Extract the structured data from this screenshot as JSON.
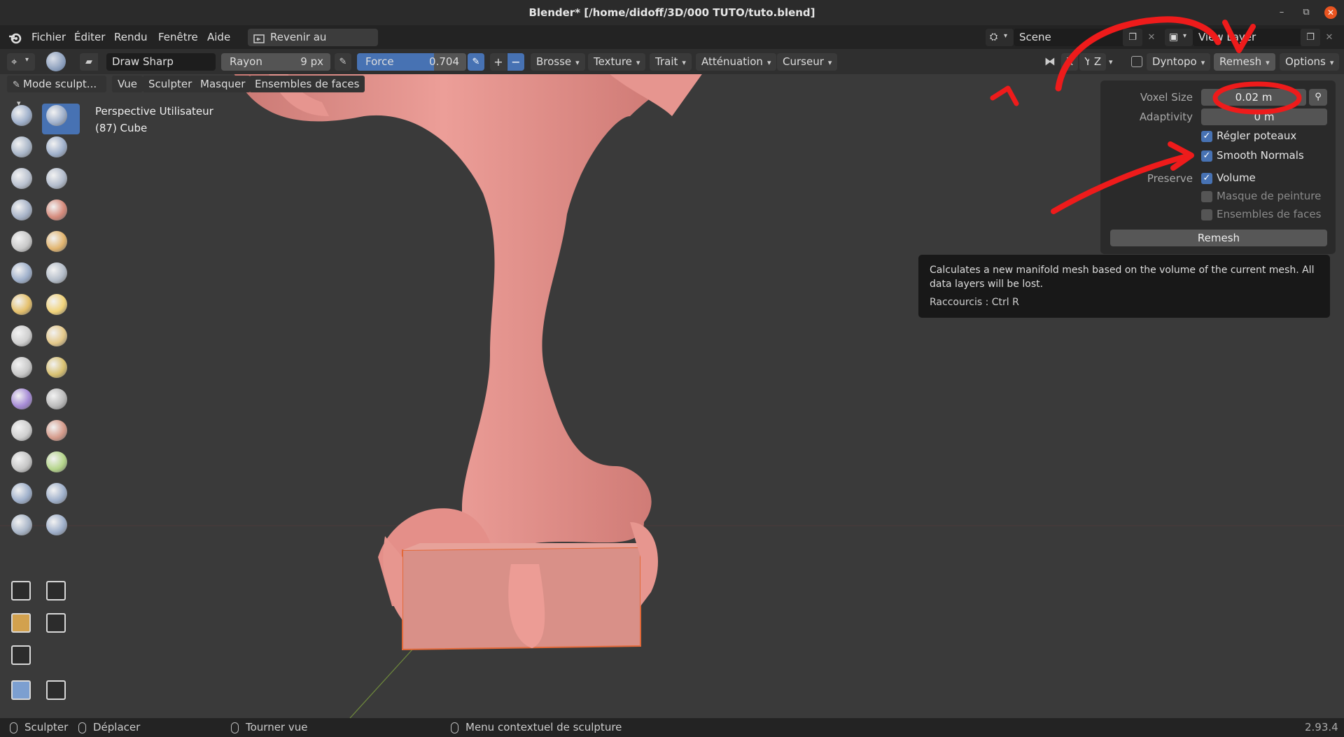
{
  "window": {
    "title": "Blender* [/home/didoff/3D/000 TUTO/tuto.blend]"
  },
  "menu": {
    "items": [
      "Fichier",
      "Éditer",
      "Rendu",
      "Fenêtre",
      "Aide"
    ],
    "revert_label": "Revenir au précédent"
  },
  "scene": {
    "name": "Scene",
    "view_layer": "View Layer"
  },
  "tool_header": {
    "brush_name": "Draw Sharp",
    "radius_label": "Rayon",
    "radius_value": "9 px",
    "strength_label": "Force",
    "strength_value": "0.704",
    "strength_fraction": 0.704,
    "menus": [
      "Brosse",
      "Texture",
      "Trait",
      "Atténuation",
      "Curseur"
    ],
    "symmetry": [
      "X",
      "Y",
      "Z"
    ],
    "dyntopo_label": "Dyntopo",
    "remesh_label": "Remesh",
    "options_label": "Options"
  },
  "viewport_header": {
    "mode": "Mode sculpt...",
    "items": [
      "Vue",
      "Sculpter",
      "Masquer",
      "Ensembles de faces"
    ]
  },
  "viewport": {
    "view_name": "Perspective Utilisateur",
    "object_info": "(87) Cube"
  },
  "remesh_popover": {
    "voxel_size_label": "Voxel Size",
    "voxel_size_value": "0.02 m",
    "adaptivity_label": "Adaptivity",
    "adaptivity_value": "0 m",
    "fix_poles_label": "Régler poteaux",
    "smooth_normals_label": "Smooth Normals",
    "preserve_label": "Preserve",
    "preserve_volume_label": "Volume",
    "preserve_paint_mask_label": "Masque de peinture",
    "preserve_face_sets_label": "Ensembles de faces",
    "remesh_button": "Remesh"
  },
  "tooltip": {
    "description": "Calculates a new manifold mesh based on the volume of the current mesh. All data layers will be lost.",
    "shortcut": "Raccourcis  : Ctrl R"
  },
  "annotation": {
    "number": "1"
  },
  "status_bar": {
    "items": [
      "Sculpter",
      "Déplacer",
      "Tourner vue",
      "Menu contextuel de sculpture"
    ],
    "version": "2.93.4"
  },
  "colors": {
    "accent": "#4772b3",
    "mesh": "#e5958f",
    "annotation": "#ee1b1b",
    "background": "#3a3a3a"
  },
  "icons": [
    "blender-logo-icon",
    "eyedropper-icon",
    "pressure-pen-icon",
    "scene-icon",
    "view-layer-icon",
    "sculpt-mode-icon",
    "brush-icon",
    "mirror-icon"
  ]
}
